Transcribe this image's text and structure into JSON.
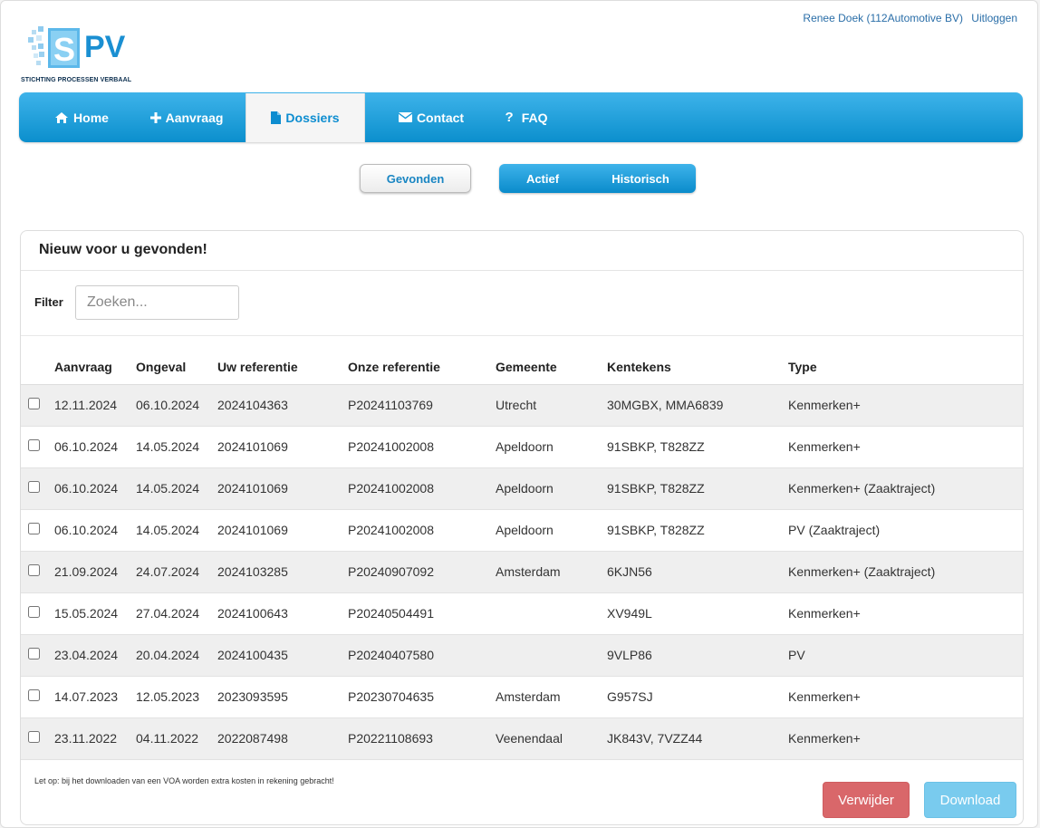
{
  "header": {
    "user": "Renee Doek (112Automotive BV)",
    "logout": "Uitloggen",
    "logo_letters": "PV",
    "logo_subtitle": "STICHTING PROCESSEN VERBAAL"
  },
  "nav": {
    "items": [
      {
        "label": "Home",
        "icon": "home-icon"
      },
      {
        "label": "Aanvraag",
        "icon": "plus-icon"
      },
      {
        "label": "Dossiers",
        "icon": "file-icon"
      },
      {
        "label": "Contact",
        "icon": "envelope-icon"
      },
      {
        "label": "FAQ",
        "icon": "question-icon"
      }
    ],
    "active": "Dossiers"
  },
  "subnav": {
    "gevonden": "Gevonden",
    "actief": "Actief",
    "historisch": "Historisch"
  },
  "panel": {
    "title": "Nieuw voor u gevonden!",
    "filter_label": "Filter",
    "filter_placeholder": "Zoeken...",
    "filter_value": ""
  },
  "table": {
    "columns": [
      "Aanvraag",
      "Ongeval",
      "Uw referentie",
      "Onze referentie",
      "Gemeente",
      "Kentekens",
      "Type"
    ],
    "rows": [
      [
        "12.11.2024",
        "06.10.2024",
        "2024104363",
        "P20241103769",
        "Utrecht",
        "30MGBX, MMA6839",
        "Kenmerken+"
      ],
      [
        "06.10.2024",
        "14.05.2024",
        "2024101069",
        "P20241002008",
        "Apeldoorn",
        "91SBKP, T828ZZ",
        "Kenmerken+"
      ],
      [
        "06.10.2024",
        "14.05.2024",
        "2024101069",
        "P20241002008",
        "Apeldoorn",
        "91SBKP, T828ZZ",
        "Kenmerken+ (Zaaktraject)"
      ],
      [
        "06.10.2024",
        "14.05.2024",
        "2024101069",
        "P20241002008",
        "Apeldoorn",
        "91SBKP, T828ZZ",
        "PV (Zaaktraject)"
      ],
      [
        "21.09.2024",
        "24.07.2024",
        "2024103285",
        "P20240907092",
        "Amsterdam",
        "6KJN56",
        "Kenmerken+ (Zaaktraject)"
      ],
      [
        "15.05.2024",
        "27.04.2024",
        "2024100643",
        "P20240504491",
        "",
        "XV949L",
        "Kenmerken+"
      ],
      [
        "23.04.2024",
        "20.04.2024",
        "2024100435",
        "P20240407580",
        "",
        "9VLP86",
        "PV"
      ],
      [
        "14.07.2023",
        "12.05.2023",
        "2023093595",
        "P20230704635",
        "Amsterdam",
        "G957SJ",
        "Kenmerken+"
      ],
      [
        "23.11.2022",
        "04.11.2022",
        "2022087498",
        "P20221108693",
        "Veenendaal",
        "JK843V, 7VZZ44",
        "Kenmerken+"
      ]
    ]
  },
  "footer": {
    "note": "Let op: bij het downloaden van een VOA worden extra kosten in rekening gebracht!",
    "delete_label": "Verwijder",
    "download_label": "Download"
  },
  "colors": {
    "primary": "#0d8dd0",
    "danger": "#d9676a",
    "download_disabled": "#79cbee"
  }
}
